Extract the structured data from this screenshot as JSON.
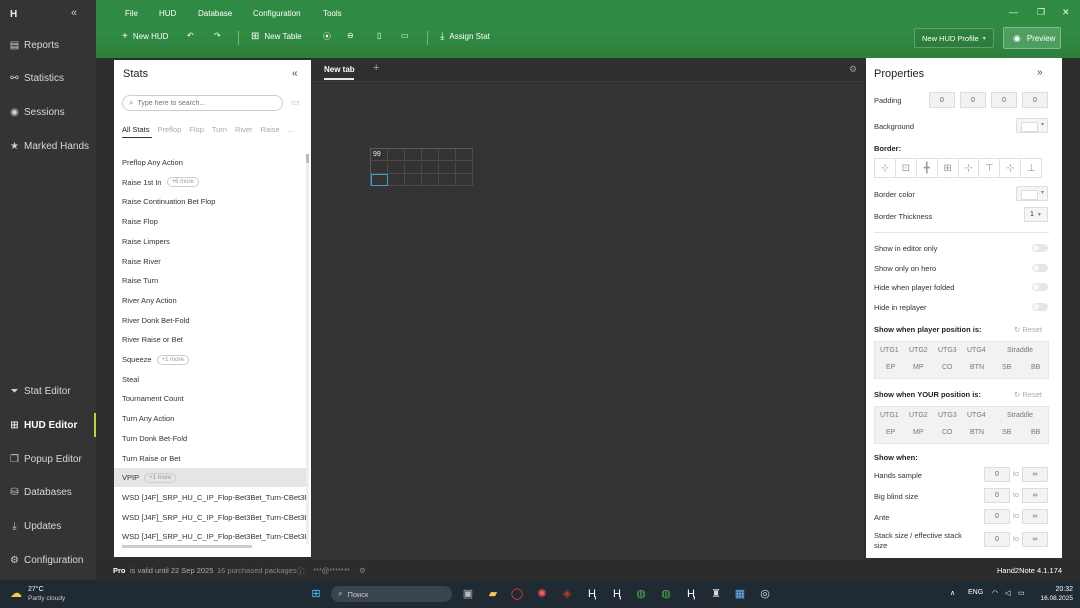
{
  "nav": {
    "logo": "H",
    "items": [
      {
        "label": "Reports",
        "icon": "document-icon"
      },
      {
        "label": "Statistics",
        "icon": "network-icon"
      },
      {
        "label": "Sessions",
        "icon": "radio-icon"
      },
      {
        "label": "Marked Hands",
        "icon": "star-icon"
      },
      {
        "label": "Stat Editor",
        "icon": "funnel-icon"
      },
      {
        "label": "HUD Editor",
        "icon": "grid-icon"
      },
      {
        "label": "Popup Editor",
        "icon": "popup-icon"
      },
      {
        "label": "Databases",
        "icon": "database-icon"
      },
      {
        "label": "Updates",
        "icon": "download-icon"
      },
      {
        "label": "Configuration",
        "icon": "gear-icon"
      }
    ]
  },
  "menu": [
    "File",
    "HUD",
    "Database",
    "Configuration",
    "Tools"
  ],
  "toolbar": {
    "new_hud": "New HUD",
    "new_table": "New Table",
    "assign_stat": "Assign Stat",
    "profile": "New HUD Profile",
    "preview": "Preview"
  },
  "stats": {
    "title": "Stats",
    "search_placeholder": "Type here to search...",
    "tabs": [
      "All Stats",
      "Preflop",
      "Flop",
      "Turn",
      "River",
      "Raise",
      "..."
    ],
    "items": [
      {
        "label": "Preflop Any Action",
        "more": ""
      },
      {
        "label": "Raise 1st In",
        "more": "+6 more"
      },
      {
        "label": "Raise Continuation Bet Flop",
        "more": ""
      },
      {
        "label": "Raise Flop",
        "more": ""
      },
      {
        "label": "Raise Limpers",
        "more": ""
      },
      {
        "label": "Raise River",
        "more": ""
      },
      {
        "label": "Raise Turn",
        "more": ""
      },
      {
        "label": "River Any Action",
        "more": ""
      },
      {
        "label": "River Donk Bet-Fold",
        "more": ""
      },
      {
        "label": "River Raise or Bet",
        "more": ""
      },
      {
        "label": "Squeeze",
        "more": "+1 more"
      },
      {
        "label": "Steal",
        "more": ""
      },
      {
        "label": "Tournament Count",
        "more": ""
      },
      {
        "label": "Turn Any Action",
        "more": ""
      },
      {
        "label": "Turn Donk Bet-Fold",
        "more": ""
      },
      {
        "label": "Turn Raise or Bet",
        "more": ""
      },
      {
        "label": "VPIP",
        "more": "+1 more"
      },
      {
        "label": "WSD [J4F]_SRP_HU_C_IP_Flop-Bet3Bet_Turn-CBet3Bet",
        "more": ""
      },
      {
        "label": "WSD [J4F]_SRP_HU_C_IP_Flop-Bet3Bet_Turn-CBet3Bet",
        "more": ""
      },
      {
        "label": "WSD [J4F]_SRP_HU_C_IP_Flop-Bet3Bet_Turn-CBet3Bet",
        "more": ""
      }
    ]
  },
  "editor": {
    "tab": "New tab",
    "cell_value": "99"
  },
  "props": {
    "title": "Properties",
    "padding": "Padding",
    "padding_values": [
      "0",
      "0",
      "0",
      "0"
    ],
    "background": "Background",
    "border": "Border:",
    "border_color": "Border color",
    "border_thickness": "Border Thickness",
    "thickness_value": "1",
    "show_in_editor": "Show in editor only",
    "show_on_hero": "Show only on hero",
    "hide_folded": "Hide when player folded",
    "hide_replayer": "Hide in replayer",
    "player_pos": "Show when player position is:",
    "your_pos": "Show when YOUR position is:",
    "reset": "Reset",
    "positions_row1": [
      "UTG1",
      "UTG2",
      "UTG3",
      "UTG4",
      "Straddle"
    ],
    "positions_row2": [
      "EP",
      "MP",
      "CO",
      "BTN",
      "SB",
      "BB"
    ],
    "show_when": "Show when:",
    "ranges": [
      {
        "label": "Hands sample",
        "from": "0",
        "to": "∞"
      },
      {
        "label": "Big blind size",
        "from": "0",
        "to": "∞"
      },
      {
        "label": "Ante",
        "from": "0",
        "to": "∞"
      },
      {
        "label": "Stack size / effective stack size",
        "from": "0",
        "to": "∞"
      }
    ],
    "to_label": "to"
  },
  "status": {
    "pro": "Pro",
    "valid": "is valid until 22 Sep 2025",
    "packages": "16 purchased packages",
    "email": "***@*******",
    "version": "Hand2Note 4.1.174"
  },
  "taskbar": {
    "temp": "27°C",
    "weather": "Partly cloudy",
    "search": "Поиск",
    "lang": "ENG",
    "time": "20:32",
    "date": "16.08.2025"
  }
}
